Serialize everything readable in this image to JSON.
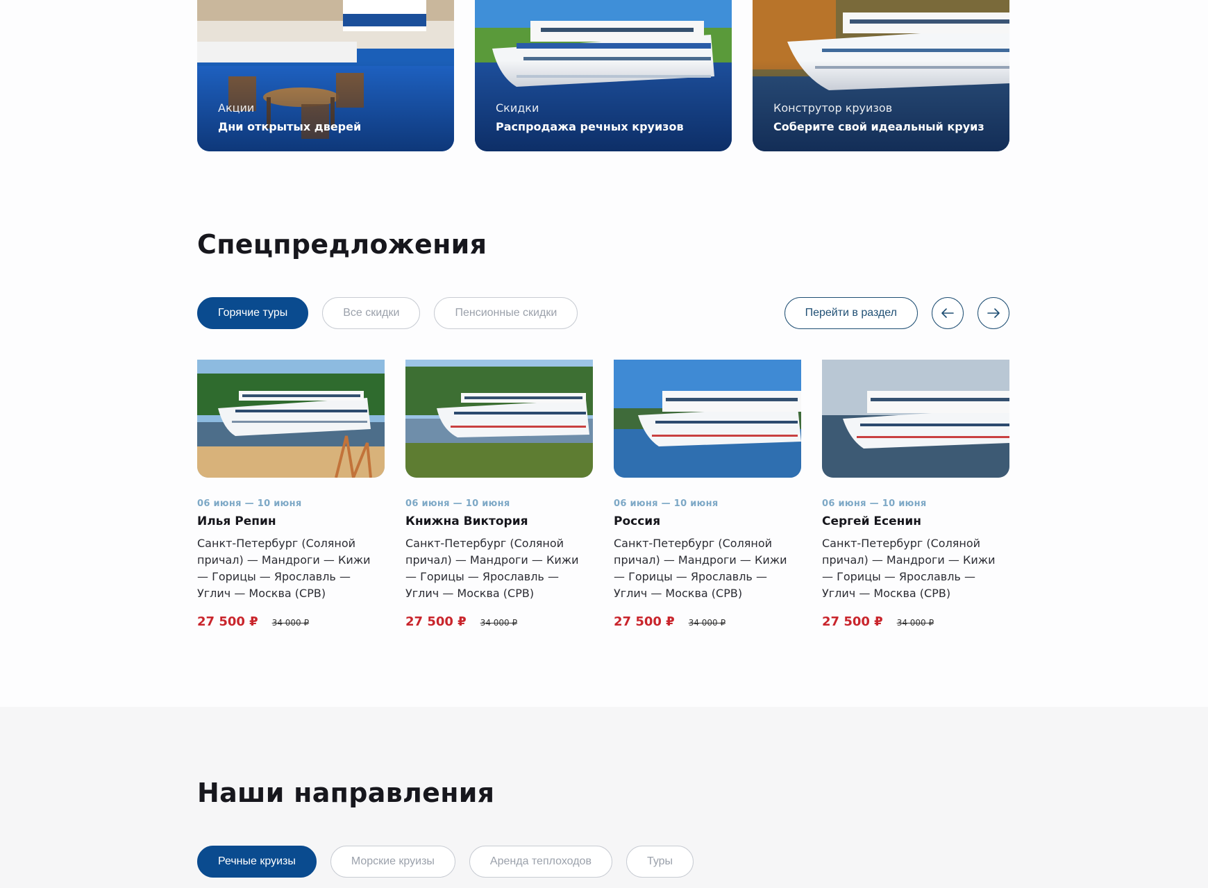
{
  "promos": [
    {
      "category": "Акции",
      "title": "Дни открытых дверей"
    },
    {
      "category": "Скидки",
      "title": "Распродажа речных круизов"
    },
    {
      "category": "Конструтор круизов",
      "title": "Соберите свой идеальный круиз"
    }
  ],
  "special": {
    "title": "Спецпредложения",
    "tabs": [
      "Горячие туры",
      "Все скидки",
      "Пенсионные скидки"
    ],
    "goto_label": "Перейти в раздел",
    "prev_icon": "arrow-left-icon",
    "next_icon": "arrow-right-icon"
  },
  "cruises": [
    {
      "dates": "06 июня — 10 июня",
      "name": "Илья Репин",
      "route": "Санкт-Петербург (Соляной причал) — Мандроги — Кижи — Горицы — Ярославль — Углич — Москва (СРВ)",
      "price": "27 500 ₽",
      "old_price": "34 000 ₽"
    },
    {
      "dates": "06 июня — 10 июня",
      "name": "Книжна Виктория",
      "route": "Санкт-Петербург (Соляной причал) — Мандроги — Кижи — Горицы — Ярославль — Углич — Москва (СРВ)",
      "price": "27 500 ₽",
      "old_price": "34 000 ₽"
    },
    {
      "dates": "06 июня — 10 июня",
      "name": "Россия",
      "route": "Санкт-Петербург (Соляной причал) — Мандроги — Кижи — Горицы — Ярославль — Углич — Москва (СРВ)",
      "price": "27 500 ₽",
      "old_price": "34 000 ₽"
    },
    {
      "dates": "06 июня — 10 июня",
      "name": "Сергей Есенин",
      "route": "Санкт-Петербург (Соляной причал) — Мандроги — Кижи — Горицы — Ярославль — Углич — Москва (СРВ)",
      "price": "27 500 ₽",
      "old_price": "34 000 ₽"
    }
  ],
  "directions": {
    "title": "Наши направления",
    "tabs": [
      "Речные круизы",
      "Морские круизы",
      "Аренда теплоходов",
      "Туры"
    ]
  },
  "colors": {
    "accent": "#0a4b8f",
    "price": "#c9252c",
    "dates": "#7da8c6"
  }
}
